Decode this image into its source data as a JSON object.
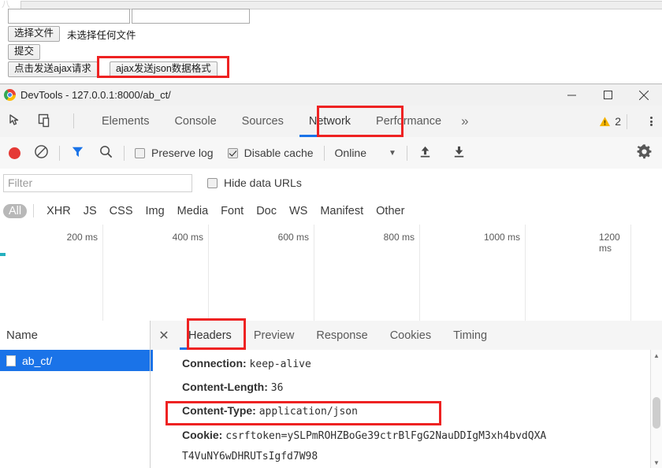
{
  "page_form": {
    "input_a_value": "",
    "input_b_value": "",
    "file_button_label": "选择文件",
    "file_status": "未选择任何文件",
    "submit_label": "提交",
    "ajax_button_label": "点击发送ajax请求",
    "ajax_json_button_label": "ajax发送json数据格式"
  },
  "devtools": {
    "title": "DevTools - 127.0.0.1:8000/ab_ct/",
    "window_controls": {
      "minimize": "minimize-icon",
      "maximize": "maximize-icon",
      "close": "close-icon"
    },
    "tabs": [
      {
        "label": "Elements",
        "active": false
      },
      {
        "label": "Console",
        "active": false
      },
      {
        "label": "Sources",
        "active": false
      },
      {
        "label": "Network",
        "active": true
      },
      {
        "label": "Performance",
        "active": false
      }
    ],
    "more_tabs_label": "»",
    "warning_count": "2",
    "toolbar": {
      "record_icon": "record-icon",
      "clear_icon": "clear-icon",
      "filter_icon": "filter-icon",
      "search_icon": "search-icon",
      "preserve_log_label": "Preserve log",
      "preserve_log_checked": false,
      "disable_cache_label": "Disable cache",
      "disable_cache_checked": true,
      "throttling_value": "Online",
      "import_icon": "upload-icon",
      "export_icon": "download-icon",
      "settings_icon": "gear-icon"
    },
    "filter_row": {
      "filter_placeholder": "Filter",
      "filter_value": "",
      "hide_data_urls_label": "Hide data URLs",
      "hide_data_urls_checked": false
    },
    "type_filters": [
      {
        "label": "All",
        "selected": true
      },
      {
        "label": "XHR",
        "selected": false
      },
      {
        "label": "JS",
        "selected": false
      },
      {
        "label": "CSS",
        "selected": false
      },
      {
        "label": "Img",
        "selected": false
      },
      {
        "label": "Media",
        "selected": false
      },
      {
        "label": "Font",
        "selected": false
      },
      {
        "label": "Doc",
        "selected": false
      },
      {
        "label": "WS",
        "selected": false
      },
      {
        "label": "Manifest",
        "selected": false
      },
      {
        "label": "Other",
        "selected": false
      }
    ],
    "timeline": {
      "ticks": [
        "200 ms",
        "400 ms",
        "600 ms",
        "800 ms",
        "1000 ms",
        "1200 ms"
      ],
      "bar_color": "#25b0bf"
    },
    "request_table": {
      "name_column_header": "Name",
      "rows": [
        {
          "name": "ab_ct/",
          "selected": true
        }
      ]
    },
    "detail_tabs": [
      {
        "label": "Headers",
        "active": true
      },
      {
        "label": "Preview",
        "active": false
      },
      {
        "label": "Response",
        "active": false
      },
      {
        "label": "Cookies",
        "active": false
      },
      {
        "label": "Timing",
        "active": false
      }
    ],
    "headers": [
      {
        "key": "Connection:",
        "value": "keep-alive"
      },
      {
        "key": "Content-Length:",
        "value": "36"
      },
      {
        "key": "Content-Type:",
        "value": "application/json"
      },
      {
        "key": "Cookie:",
        "value": "csrftoken=ySLPmROHZBoGe39ctrBlFgG2NauDDIgM3xh4bvdQXA"
      },
      {
        "key": "",
        "value": "T4VuNY6wDHRUTsIgfd7W98"
      }
    ]
  },
  "highlights": {
    "accent_color": "#ee2222",
    "boxes": [
      "ajax-json-button",
      "network-tab",
      "headers-tab",
      "content-type-header"
    ]
  }
}
